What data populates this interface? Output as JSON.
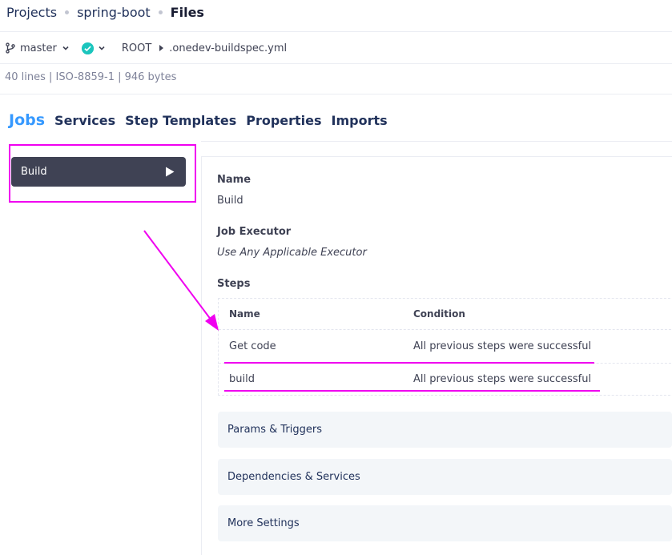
{
  "breadcrumb": {
    "items": [
      "Projects",
      "spring-boot"
    ],
    "current": "Files"
  },
  "toolbar": {
    "branch_icon": "git-branch-icon",
    "branch": "master",
    "build_status_icon": "check-circle-icon",
    "path_root": "ROOT",
    "path_file": ".onedev-buildspec.yml"
  },
  "file_info": "40 lines | ISO-8859-1 | 946 bytes",
  "tabs": [
    "Jobs",
    "Services",
    "Step Templates",
    "Properties",
    "Imports"
  ],
  "active_tab": "Jobs",
  "jobs": [
    {
      "name": "Build",
      "icon": "play-icon"
    }
  ],
  "job_detail": {
    "name_label": "Name",
    "name_value": "Build",
    "executor_label": "Job Executor",
    "executor_value": "Use Any Applicable Executor",
    "steps_label": "Steps",
    "steps_columns": [
      "Name",
      "Condition"
    ],
    "steps": [
      {
        "name": "Get code",
        "condition": "All previous steps were successful"
      },
      {
        "name": "build",
        "condition": "All previous steps were successful"
      }
    ],
    "sections": [
      "Params & Triggers",
      "Dependencies & Services",
      "More Settings"
    ]
  },
  "colors": {
    "accent": "#3699ff",
    "annotation": "#f000f0",
    "job_selected_bg": "#3f4254",
    "success": "#1bc5bd"
  }
}
